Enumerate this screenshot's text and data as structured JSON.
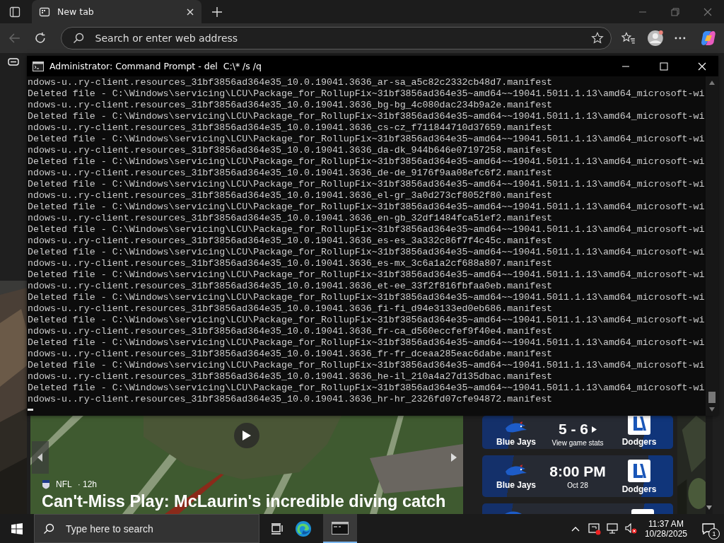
{
  "browser": {
    "tab": {
      "title": "New tab",
      "selected": true
    },
    "address_bar": {
      "placeholder": "Search or enter web address"
    }
  },
  "console": {
    "title": "Administrator: Command Prompt - del  C:\\* /s /q",
    "lines": [
      "ndows-u..ry-client.resources_31bf3856ad364e35_10.0.19041.3636_ar-sa_a5c82c2332cb48d7.manifest",
      "Deleted file - C:\\Windows\\servicing\\LCU\\Package_for_RollupFix~31bf3856ad364e35~amd64~~19041.5011.1.13\\amd64_microsoft-wi",
      "ndows-u..ry-client.resources_31bf3856ad364e35_10.0.19041.3636_bg-bg_4c080dac234b9a2e.manifest",
      "Deleted file - C:\\Windows\\servicing\\LCU\\Package_for_RollupFix~31bf3856ad364e35~amd64~~19041.5011.1.13\\amd64_microsoft-wi",
      "ndows-u..ry-client.resources_31bf3856ad364e35_10.0.19041.3636_cs-cz_f711844710d37659.manifest",
      "Deleted file - C:\\Windows\\servicing\\LCU\\Package_for_RollupFix~31bf3856ad364e35~amd64~~19041.5011.1.13\\amd64_microsoft-wi",
      "ndows-u..ry-client.resources_31bf3856ad364e35_10.0.19041.3636_da-dk_944b646e07197258.manifest",
      "Deleted file - C:\\Windows\\servicing\\LCU\\Package_for_RollupFix~31bf3856ad364e35~amd64~~19041.5011.1.13\\amd64_microsoft-wi",
      "ndows-u..ry-client.resources_31bf3856ad364e35_10.0.19041.3636_de-de_9176f9aa08efc6f2.manifest",
      "Deleted file - C:\\Windows\\servicing\\LCU\\Package_for_RollupFix~31bf3856ad364e35~amd64~~19041.5011.1.13\\amd64_microsoft-wi",
      "ndows-u..ry-client.resources_31bf3856ad364e35_10.0.19041.3636_el-gr_3a0d273cf8052f80.manifest",
      "Deleted file - C:\\Windows\\servicing\\LCU\\Package_for_RollupFix~31bf3856ad364e35~amd64~~19041.5011.1.13\\amd64_microsoft-wi",
      "ndows-u..ry-client.resources_31bf3856ad364e35_10.0.19041.3636_en-gb_32df1484fca51ef2.manifest",
      "Deleted file - C:\\Windows\\servicing\\LCU\\Package_for_RollupFix~31bf3856ad364e35~amd64~~19041.5011.1.13\\amd64_microsoft-wi",
      "ndows-u..ry-client.resources_31bf3856ad364e35_10.0.19041.3636_es-es_3a332c86f7f4c45c.manifest",
      "Deleted file - C:\\Windows\\servicing\\LCU\\Package_for_RollupFix~31bf3856ad364e35~amd64~~19041.5011.1.13\\amd64_microsoft-wi",
      "ndows-u..ry-client.resources_31bf3856ad364e35_10.0.19041.3636_es-mx_3c6a1a2cf688a807.manifest",
      "Deleted file - C:\\Windows\\servicing\\LCU\\Package_for_RollupFix~31bf3856ad364e35~amd64~~19041.5011.1.13\\amd64_microsoft-wi",
      "ndows-u..ry-client.resources_31bf3856ad364e35_10.0.19041.3636_et-ee_33f2f816fbfaa0eb.manifest",
      "Deleted file - C:\\Windows\\servicing\\LCU\\Package_for_RollupFix~31bf3856ad364e35~amd64~~19041.5011.1.13\\amd64_microsoft-wi",
      "ndows-u..ry-client.resources_31bf3856ad364e35_10.0.19041.3636_fi-fi_d94e3133ed0eb686.manifest",
      "Deleted file - C:\\Windows\\servicing\\LCU\\Package_for_RollupFix~31bf3856ad364e35~amd64~~19041.5011.1.13\\amd64_microsoft-wi",
      "ndows-u..ry-client.resources_31bf3856ad364e35_10.0.19041.3636_fr-ca_d560eccfef9f40e4.manifest",
      "Deleted file - C:\\Windows\\servicing\\LCU\\Package_for_RollupFix~31bf3856ad364e35~amd64~~19041.5011.1.13\\amd64_microsoft-wi",
      "ndows-u..ry-client.resources_31bf3856ad364e35_10.0.19041.3636_fr-fr_dceaa285eac6dabe.manifest",
      "Deleted file - C:\\Windows\\servicing\\LCU\\Package_for_RollupFix~31bf3856ad364e35~amd64~~19041.5011.1.13\\amd64_microsoft-wi",
      "ndows-u..ry-client.resources_31bf3856ad364e35_10.0.19041.3636_he-il_210a4a27d135dbac.manifest",
      "Deleted file - C:\\Windows\\servicing\\LCU\\Package_for_RollupFix~31bf3856ad364e35~amd64~~19041.5011.1.13\\amd64_microsoft-wi",
      "ndows-u..ry-client.resources_31bf3856ad364e35_10.0.19041.3636_hr-hr_2326fd07cfe94872.manifest"
    ]
  },
  "news": {
    "source": "NFL",
    "age": "· 12h",
    "headline": "Can't-Miss Play: McLaurin's incredible diving catch"
  },
  "scores": [
    {
      "away": "Blue Jays",
      "main": "5 - 6",
      "sub": "View game stats",
      "home": "Dodgers",
      "kind": "final"
    },
    {
      "away": "Blue Jays",
      "main": "8:00 PM",
      "sub": "Oct 28",
      "home": "Dodgers",
      "kind": "upcoming"
    }
  ],
  "taskbar": {
    "search_placeholder": "Type here to search",
    "time": "11:37 AM",
    "date": "10/28/2025",
    "notifications": "1"
  }
}
